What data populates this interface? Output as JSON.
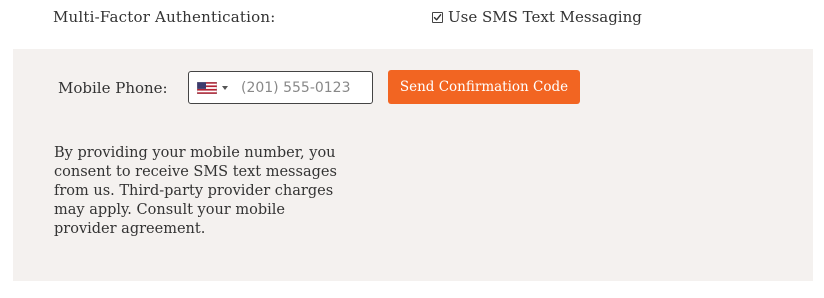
{
  "mfa": {
    "label": "Multi-Factor Authentication:",
    "sms_option_label": "Use SMS Text Messaging",
    "sms_checked": true
  },
  "phone": {
    "label": "Mobile Phone:",
    "country_flag": "us-flag-icon",
    "placeholder": "(201) 555-0123",
    "value": ""
  },
  "actions": {
    "send_code_label": "Send Confirmation Code"
  },
  "consent": {
    "text": "By providing your mobile number, you\nconsent to receive SMS text messages\nfrom us. Third-party provider charges\nmay apply. Consult your mobile\nprovider agreement."
  },
  "colors": {
    "accent": "#f26522",
    "panel_bg": "#f4f1ef",
    "text": "#333333"
  }
}
